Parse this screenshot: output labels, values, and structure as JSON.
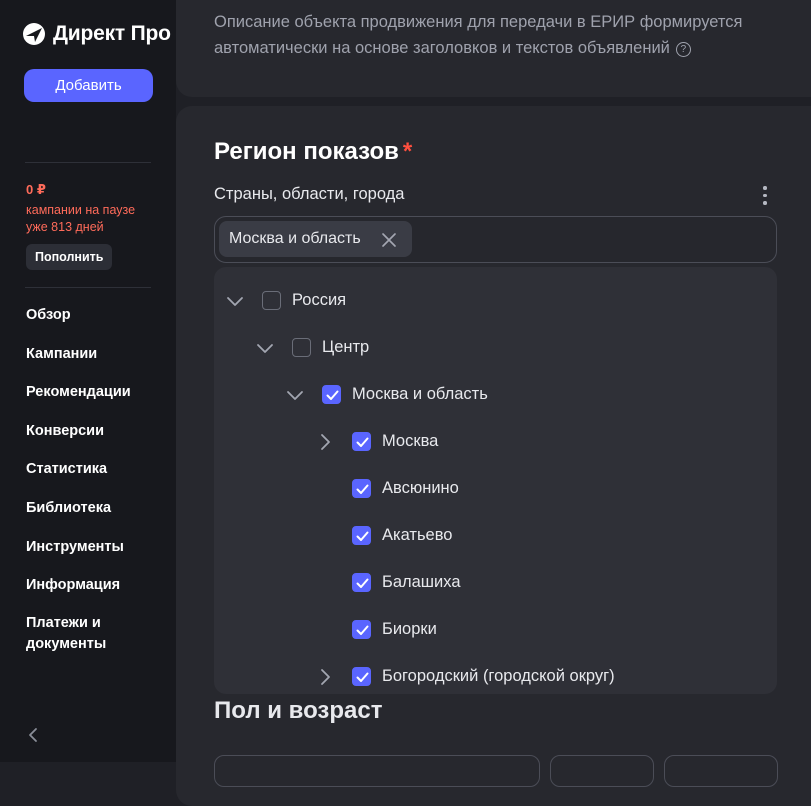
{
  "brand": {
    "name": "Директ Про",
    "accent": "#5a65ff"
  },
  "sidebar": {
    "add_label": "Добавить",
    "balance": "0 ₽",
    "paused_text": "кампании на паузе уже 813 дней",
    "topup_label": "Пополнить",
    "nav": [
      {
        "label": "Обзор"
      },
      {
        "label": "Кампании"
      },
      {
        "label": "Рекомендации"
      },
      {
        "label": "Конверсии"
      },
      {
        "label": "Статистика"
      },
      {
        "label": "Библиотека"
      },
      {
        "label": "Инструменты"
      },
      {
        "label": "Информация"
      },
      {
        "label": "Платежи и документы"
      }
    ]
  },
  "main": {
    "description": "Описание объекта продвижения для передачи в ЕРИР формируется автоматически на основе заголовков и текстов объявлений",
    "region": {
      "title": "Регион показов",
      "required_mark": "*",
      "subtitle": "Страны, области, города",
      "selected_chip": "Москва и область",
      "tree": [
        {
          "label": "Россия",
          "checked": false,
          "chevron": "down"
        },
        {
          "label": "Центр",
          "checked": false,
          "chevron": "down"
        },
        {
          "label": "Москва и область",
          "checked": true,
          "chevron": "down"
        },
        {
          "label": "Москва",
          "checked": true,
          "chevron": "right"
        },
        {
          "label": "Авсюнино",
          "checked": true,
          "chevron": "none"
        },
        {
          "label": "Акатьево",
          "checked": true,
          "chevron": "none"
        },
        {
          "label": "Балашиха",
          "checked": true,
          "chevron": "none"
        },
        {
          "label": "Биорки",
          "checked": true,
          "chevron": "none"
        },
        {
          "label": "Богородский (городской округ)",
          "checked": true,
          "chevron": "right"
        }
      ]
    },
    "age_section_title": "Пол и возраст"
  }
}
